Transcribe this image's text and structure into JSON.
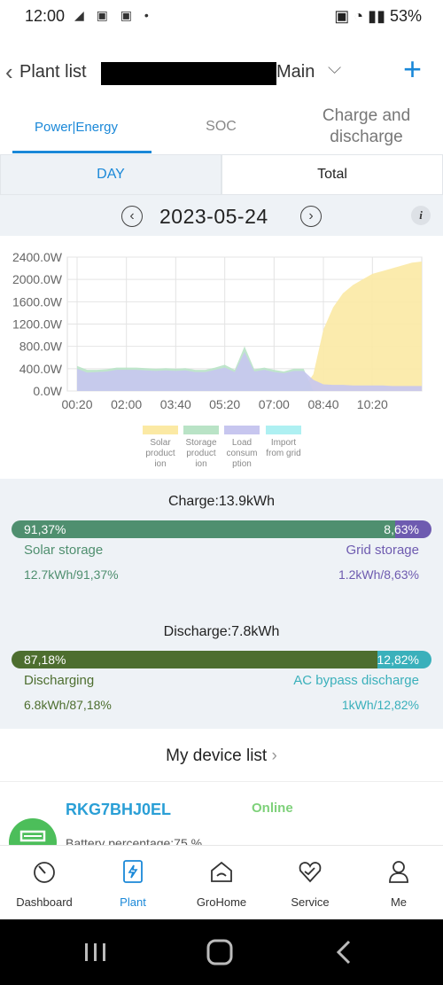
{
  "status_bar": {
    "time": "12:00",
    "left_icons": "◢ ▣ ▣ •",
    "right_text": "▣ ◔ ▮▮ 53%"
  },
  "header": {
    "back_label": "Plant list",
    "plant_name": "Main",
    "add_icon": "plus-icon"
  },
  "tabs": [
    "Power|Energy",
    "SOC",
    "Charge and discharge"
  ],
  "segments": {
    "day": "DAY",
    "total": "Total"
  },
  "date": "2023-05-24",
  "chart_data": {
    "type": "area",
    "title": "",
    "xlabel": "",
    "ylabel": "",
    "y_tick_labels": [
      "2400.0W",
      "2000.0W",
      "1600.0W",
      "1200.0W",
      "800.0W",
      "400.0W",
      "0.0W"
    ],
    "x_tick_labels": [
      "00:20",
      "02:00",
      "03:40",
      "05:20",
      "07:00",
      "08:40",
      "10:20"
    ],
    "ylim": [
      0,
      2400
    ],
    "x_hours": [
      0.33,
      0.67,
      1,
      1.33,
      1.67,
      2,
      2.33,
      2.67,
      3,
      3.33,
      3.67,
      4,
      4.33,
      4.67,
      5,
      5.33,
      5.67,
      6,
      6.33,
      6.67,
      7,
      7.33,
      7.67,
      8,
      8.33,
      8.67,
      9,
      9.33,
      9.67,
      10,
      10.33,
      10.67,
      11,
      11.33,
      11.67,
      12
    ],
    "grid": true,
    "legend_position": "bottom",
    "series": [
      {
        "name": "Solar production",
        "color": "#fbe9a4",
        "values": [
          0,
          0,
          0,
          0,
          0,
          0,
          0,
          0,
          0,
          0,
          0,
          0,
          0,
          0,
          0,
          0,
          0,
          0,
          0,
          0,
          0,
          0,
          0,
          50,
          300,
          1100,
          1500,
          1750,
          1900,
          2000,
          2100,
          2150,
          2200,
          2250,
          2300,
          2320
        ]
      },
      {
        "name": "Storage production",
        "color": "#b9e3c6",
        "values": [
          450,
          380,
          380,
          390,
          420,
          420,
          420,
          410,
          400,
          410,
          400,
          410,
          380,
          380,
          420,
          470,
          380,
          800,
          390,
          420,
          380,
          350,
          400,
          400,
          0,
          0,
          0,
          0,
          0,
          0,
          0,
          0,
          0,
          0,
          0,
          0
        ]
      },
      {
        "name": "Load consumption",
        "color": "#c7c6ef",
        "values": [
          400,
          330,
          340,
          350,
          380,
          380,
          380,
          370,
          360,
          370,
          360,
          370,
          340,
          340,
          380,
          420,
          340,
          700,
          350,
          380,
          340,
          320,
          360,
          360,
          200,
          120,
          110,
          110,
          100,
          100,
          100,
          100,
          90,
          90,
          90,
          90
        ]
      },
      {
        "name": "Import from grid",
        "color": "#aef0f2",
        "values": [
          0,
          0,
          0,
          0,
          0,
          0,
          0,
          0,
          0,
          0,
          0,
          0,
          0,
          0,
          0,
          0,
          0,
          0,
          0,
          0,
          0,
          0,
          0,
          0,
          0,
          0,
          0,
          0,
          0,
          0,
          0,
          0,
          0,
          0,
          0,
          0
        ]
      }
    ]
  },
  "legend": [
    {
      "text": "Solar product ion",
      "color": "#fbe9a4"
    },
    {
      "text": "Storage product ion",
      "color": "#b9e3c6"
    },
    {
      "text": "Load consum ption",
      "color": "#c7c6ef"
    },
    {
      "text": "Import from grid",
      "color": "#aef0f2"
    }
  ],
  "charge": {
    "title": "Charge:13.9kWh",
    "left_pct": "91,37%",
    "right_pct": "8,63%",
    "left_fraction": 0.9137,
    "left_label": "Solar storage",
    "right_label": "Grid storage",
    "left_value": "12.7kWh/91,37%",
    "right_value": "1.2kWh/8,63%",
    "left_color": "#4f8f6f",
    "right_color": "#6e5bb0"
  },
  "discharge": {
    "title": "Discharge:7.8kWh",
    "left_pct": "87,18%",
    "right_pct": "12,82%",
    "left_fraction": 0.8718,
    "left_label": "Discharging",
    "right_label": "AC bypass discharge",
    "left_value": "6.8kWh/87,18%",
    "right_value": "1kWh/12,82%",
    "left_color": "#4d6e2f",
    "right_color": "#3ab0bb"
  },
  "device_list": {
    "title": "My device list",
    "device_name": "RKG7BHJ0EL",
    "device_status": "Online",
    "battery_text": "Battery percentage:75 %"
  },
  "bottom_nav": [
    {
      "label": "Dashboard",
      "icon": "dashboard-icon"
    },
    {
      "label": "Plant",
      "icon": "plant-icon"
    },
    {
      "label": "GroHome",
      "icon": "home-icon"
    },
    {
      "label": "Service",
      "icon": "service-icon"
    },
    {
      "label": "Me",
      "icon": "profile-icon"
    }
  ],
  "colors": {
    "accent": "#1a88d8"
  }
}
